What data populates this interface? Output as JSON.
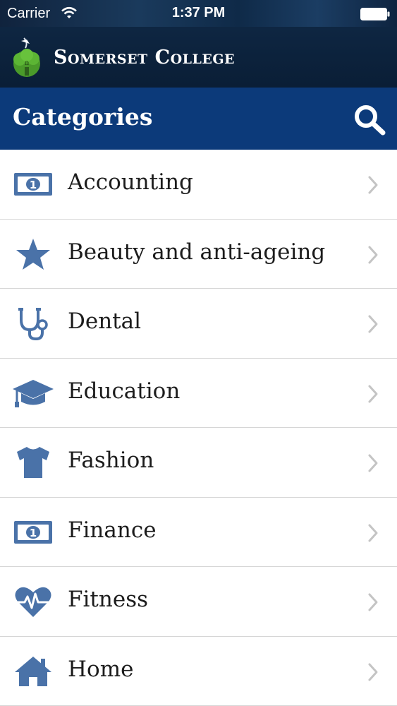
{
  "status": {
    "carrier": "Carrier",
    "time": "1:37 PM"
  },
  "brand": {
    "name": "Somerset College"
  },
  "nav": {
    "title": "Categories"
  },
  "colors": {
    "icon": "#4a72a8",
    "nav": "#0c3a7a",
    "brand": "#0a1e36"
  },
  "categories": [
    {
      "label": "Accounting",
      "icon": "money-icon"
    },
    {
      "label": "Beauty and anti-ageing",
      "icon": "star-icon"
    },
    {
      "label": "Dental",
      "icon": "stethoscope-icon"
    },
    {
      "label": "Education",
      "icon": "graduation-cap-icon"
    },
    {
      "label": "Fashion",
      "icon": "tshirt-icon"
    },
    {
      "label": "Finance",
      "icon": "money-icon"
    },
    {
      "label": "Fitness",
      "icon": "heartbeat-icon"
    },
    {
      "label": "Home",
      "icon": "home-icon"
    }
  ]
}
